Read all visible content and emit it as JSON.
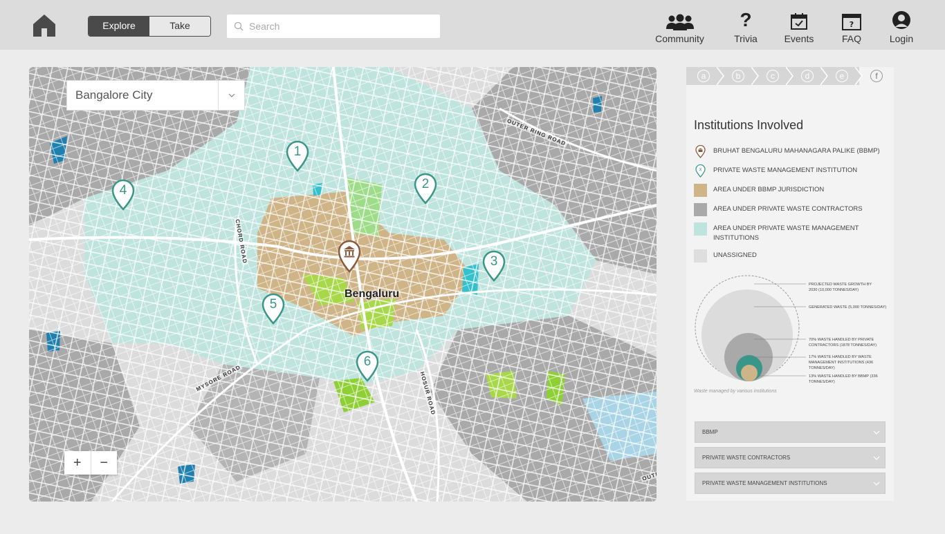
{
  "header": {
    "mode_toggle": {
      "explore_label": "Explore",
      "take_action_label": "Take Action"
    },
    "search": {
      "placeholder": "Search",
      "value": ""
    },
    "nav": [
      {
        "label": "Community",
        "icon": "community-icon"
      },
      {
        "label": "Trivia",
        "icon": "question-icon"
      },
      {
        "label": "Events",
        "icon": "calendar-icon"
      },
      {
        "label": "FAQ",
        "icon": "faq-icon"
      },
      {
        "label": "Login",
        "icon": "user-icon"
      }
    ]
  },
  "map": {
    "city_select": "Bangalore City",
    "city_label": "Bengaluru",
    "roads": [
      "OUTER RING ROAD",
      "CHORD ROAD",
      "MYSORE ROAD",
      "HOSUR ROAD",
      "OUTE"
    ],
    "markers": [
      "1",
      "2",
      "3",
      "4",
      "5",
      "6"
    ],
    "zoom_in": "+",
    "zoom_out": "−"
  },
  "panel": {
    "steps": [
      "a",
      "b",
      "c",
      "d",
      "e",
      "f"
    ],
    "active_step": "f",
    "title": "Institutions Involved",
    "legend": [
      {
        "label": "BRUHAT BENGALURU MAHANAGARA PALIKE (BBMP)",
        "icon": "bbmp-pin-icon",
        "color": "#8b5a3c"
      },
      {
        "label": "PRIVATE WASTE MANAGEMENT INSTITUTION",
        "icon": "private-pin-icon",
        "color": "#3a9688"
      },
      {
        "label": "AREA UNDER BBMP JURISDICTION",
        "color": "#cfb487"
      },
      {
        "label": "AREA UNDER PRIVATE WASTE CONTRACTORS",
        "color": "#a9a9a9"
      },
      {
        "label": "AREA UNDER PRIVATE WASTE MANAGEMENT INSTITUTIONS",
        "color": "#bfe3dd"
      },
      {
        "label": "UNASSIGNED",
        "color": "#dedede"
      }
    ],
    "bubble_labels": [
      "PROJECTED WASTE GROWTH BY 2030 (10,000 TONNES/DAY)",
      "GENERATED WASTE (5,000 TONNES/DAY)",
      "70% WASTE HANDLED BY PRIVATE CONTRACTORS (1878 TONNES/DAY)",
      "17% WASTE HANDLED BY WASTE MANAGEMENT INSTITUTIONS (436 TONNES/DAY)",
      "13% WASTE HANDLED BY BBMP (336 TONNES/DAY)"
    ],
    "bubble_caption": "Waste managed by various institutions",
    "accordions": [
      "BBMP",
      "PRIVATE WASTE CONTRACTORS",
      "PRIVATE WASTE MANAGEMENT INSTITUTIONS"
    ]
  },
  "colors": {
    "teal": "#3a9688",
    "bbmp_brown": "#8b5a3c",
    "bbmp_area": "#cfb487",
    "private_area": "#a9a9a9",
    "institution_area": "#bfe3dd",
    "park_green": "#a8d84a",
    "water_blue": "#1f7fae"
  }
}
